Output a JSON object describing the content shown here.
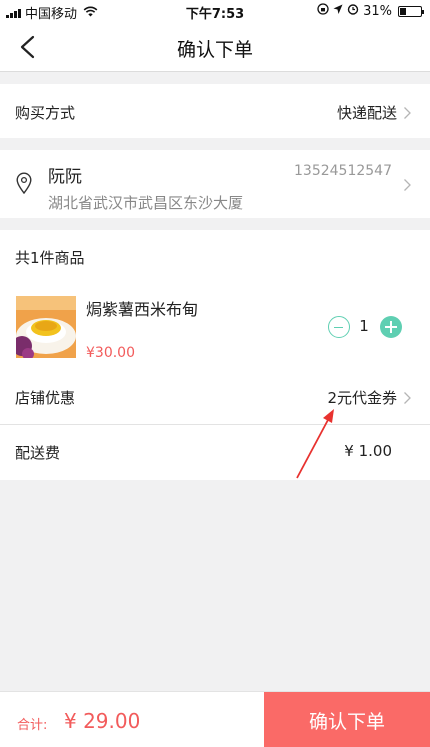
{
  "status_bar": {
    "carrier": "中国移动",
    "time": "下午7:53",
    "battery": "31%",
    "battery_level": 0.31
  },
  "nav": {
    "title": "确认下单"
  },
  "purchase_method": {
    "label": "购买方式",
    "value": "快递配送"
  },
  "address": {
    "name": "阮阮",
    "phone": "13524512547",
    "detail": "湖北省武汉市武昌区东沙大厦"
  },
  "goods": {
    "count_label": "共1件商品",
    "items": [
      {
        "name": "焗紫薯西米布甸",
        "price": "¥30.00",
        "quantity": "1"
      }
    ]
  },
  "store_discount": {
    "label": "店铺优惠",
    "value": "2元代金券"
  },
  "delivery_fee": {
    "label": "配送费",
    "value": "¥ 1.00"
  },
  "footer": {
    "total_label": "合计:",
    "total_value": "¥ 29.00",
    "confirm_label": "确认下单"
  },
  "colors": {
    "accent_red": "#fa6a67",
    "price_red": "#f25b5b",
    "stepper_green": "#5fcfb2",
    "annotation_arrow": "#e8322f"
  }
}
